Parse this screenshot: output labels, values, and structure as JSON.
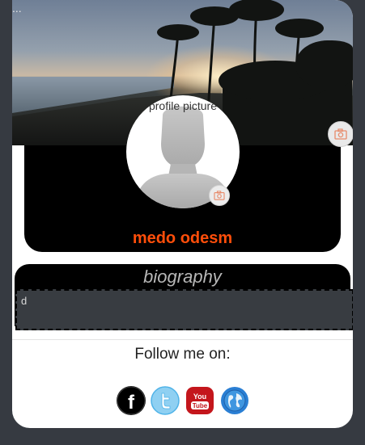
{
  "window": {
    "menu_dots": "..."
  },
  "profile": {
    "avatar_alt": "profile picture",
    "username": "medo odesm",
    "username_color": "#ff4e0a"
  },
  "cover": {
    "camera_icon": "camera-icon"
  },
  "biography": {
    "title": "biography",
    "text": "d"
  },
  "follow": {
    "label": "Follow me on:",
    "links": [
      {
        "icon": "facebook-icon",
        "letter": "f",
        "color": "#000000"
      },
      {
        "icon": "twitter-icon",
        "color": "#4fb3e8"
      },
      {
        "icon": "youtube-icon",
        "text_you": "You",
        "text_tube": "Tube",
        "color": "#c4161c"
      },
      {
        "icon": "globe-icon",
        "color": "#2a7fd4"
      }
    ]
  },
  "colors": {
    "background": "#363a41",
    "card": "#ffffff",
    "panel": "#000000",
    "accent": "#ff4e0a",
    "bio_field": "#383c41"
  }
}
